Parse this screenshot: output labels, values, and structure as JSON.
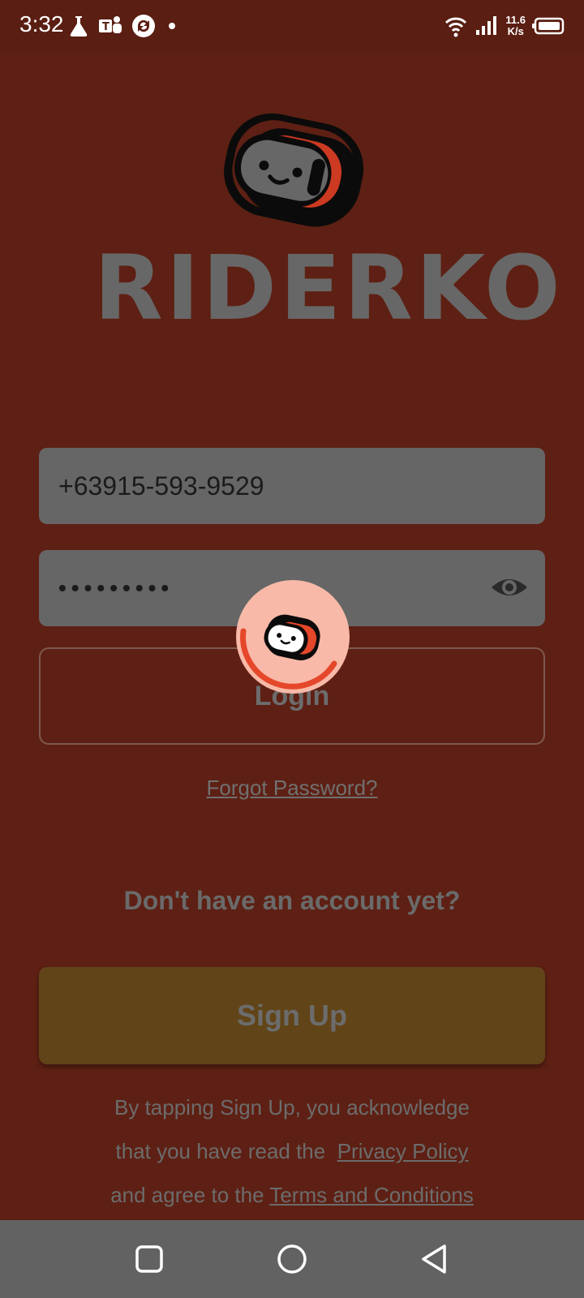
{
  "status_bar": {
    "time": "3:32",
    "net_speed_value": "11.6",
    "net_speed_unit": "K/s",
    "icons": [
      "flask-icon",
      "teams-icon",
      "sync-icon",
      "dot-icon",
      "wifi-icon",
      "signal-icon",
      "battery-icon"
    ]
  },
  "brand": {
    "name": "RIDERKO",
    "accent_color": "#e5472a"
  },
  "form": {
    "phone_value": "+63915-593-9529",
    "password_masked": "•••••••••",
    "login_label": "Login",
    "forgot_password_label": "Forgot Password?"
  },
  "signup": {
    "prompt": "Don't have an account yet?",
    "button_label": "Sign Up"
  },
  "legal": {
    "line1": "By tapping Sign Up, you acknowledge",
    "line2_prefix": "that you have read the",
    "privacy_link": "Privacy Policy",
    "line3_prefix": "and agree to the",
    "terms_link": "Terms and Conditions"
  },
  "nav_bar": {
    "icons": [
      "recents-icon",
      "home-icon",
      "back-icon"
    ]
  }
}
